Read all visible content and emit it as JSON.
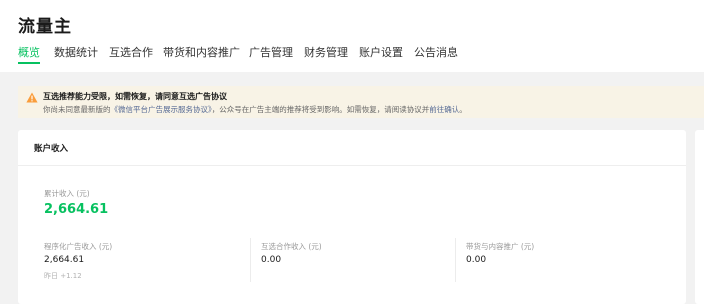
{
  "app": {
    "title": "流量主"
  },
  "tabs": [
    {
      "label": "概览",
      "active": true
    },
    {
      "label": "数据统计",
      "active": false
    },
    {
      "label": "互选合作",
      "active": false
    },
    {
      "label": "带货和内容推广",
      "active": false
    },
    {
      "label": "广告管理",
      "active": false
    },
    {
      "label": "财务管理",
      "active": false
    },
    {
      "label": "账户设置",
      "active": false
    },
    {
      "label": "公告消息",
      "active": false
    }
  ],
  "notice": {
    "title": "互选推荐能力受限，如需恢复，请同意互选广告协议",
    "text_before": "你尚未同意最新版的",
    "link1": "《微信平台广告展示服务协议》",
    "text_middle": "，公众号在广告主端的推荐将受到影响。如需恢复，请阅读协议并",
    "link2": "前往确认",
    "text_after": "。"
  },
  "account_income": {
    "title": "账户收入",
    "total_label": "累计收入 (元)",
    "total_value": "2,664.61",
    "stats": [
      {
        "label": "程序化广告收入 (元)",
        "value": "2,664.61",
        "sub": "昨日 +1.12"
      },
      {
        "label": "互选合作收入 (元)",
        "value": "0.00",
        "sub": ""
      },
      {
        "label": "带货与内容推广 (元)",
        "value": "0.00",
        "sub": ""
      }
    ]
  },
  "colors": {
    "accent": "#07c160",
    "link": "#576b95",
    "warning": "#fa9d3b",
    "notice_bg": "#f8f3e6"
  }
}
